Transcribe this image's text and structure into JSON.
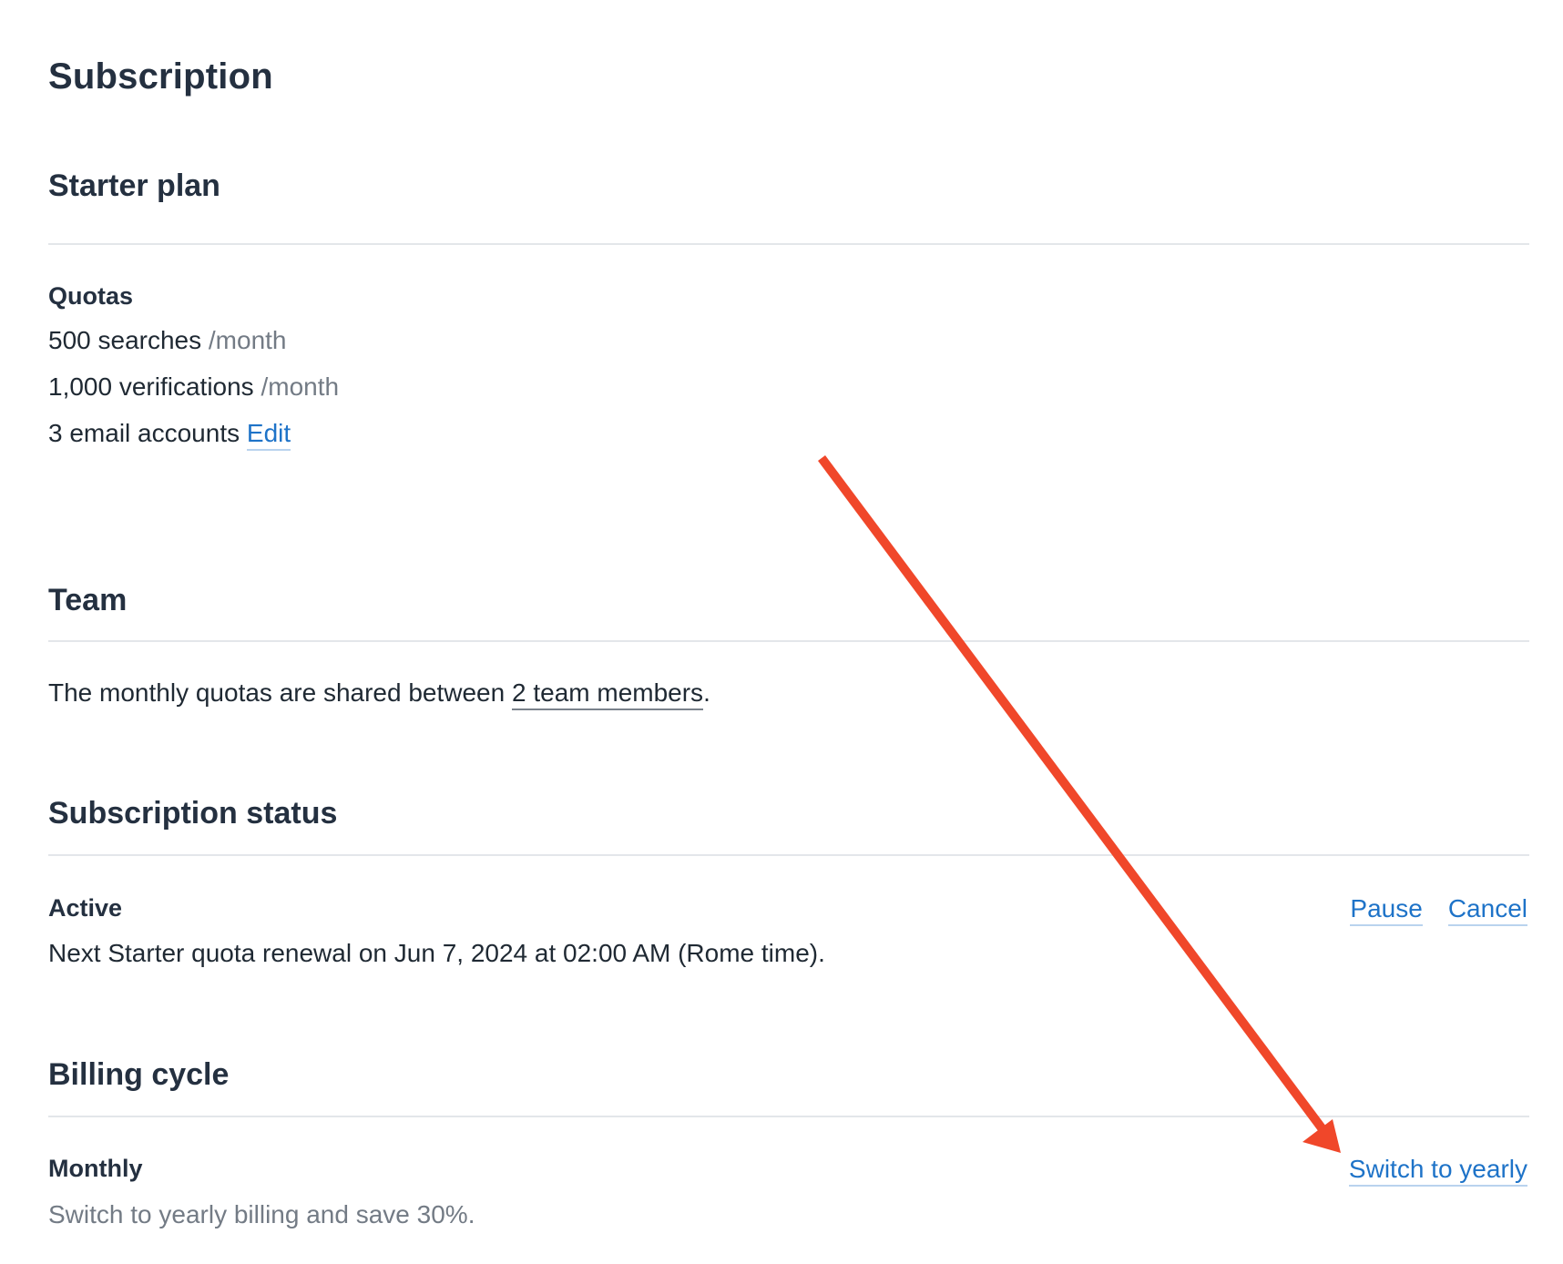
{
  "page": {
    "title": "Subscription"
  },
  "plan": {
    "title": "Starter plan",
    "quotas_label": "Quotas",
    "searches_value": "500 searches",
    "searches_unit": "/month",
    "verifications_value": "1,000 verifications",
    "verifications_unit": "/month",
    "email_accounts": "3 email accounts",
    "edit_link": "Edit"
  },
  "team": {
    "title": "Team",
    "text_before": "The monthly quotas are shared between ",
    "members_link": "2 team members",
    "text_after": "."
  },
  "status": {
    "title": "Subscription status",
    "state": "Active",
    "renewal_text": "Next Starter quota renewal on Jun 7, 2024 at 02:00 AM (Rome time).",
    "pause_link": "Pause",
    "cancel_link": "Cancel"
  },
  "billing": {
    "title": "Billing cycle",
    "cycle": "Monthly",
    "hint": "Switch to yearly billing and save 30%.",
    "switch_link": "Switch to yearly"
  },
  "colors": {
    "link": "#1e73c8",
    "annotation_arrow": "#f0472a",
    "heading": "#243040",
    "muted": "#737b85"
  }
}
